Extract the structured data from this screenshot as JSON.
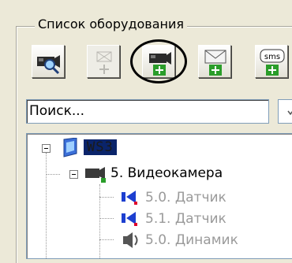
{
  "group": {
    "title": "Список оборудования"
  },
  "toolbar": {
    "buttons": [
      {
        "icon": "camera-search-icon",
        "enabled": true
      },
      {
        "icon": "device-add-icon",
        "enabled": false
      },
      {
        "icon": "camera-add-icon",
        "enabled": true,
        "highlighted": true
      },
      {
        "icon": "email-add-icon",
        "enabled": true
      },
      {
        "icon": "sms-add-icon",
        "enabled": true,
        "text": "sms"
      }
    ]
  },
  "search": {
    "value": "Поиск..."
  },
  "tree": {
    "nodes": [
      {
        "label": "WS3",
        "selected": true,
        "icon": "computer-icon"
      },
      {
        "label": "5. Видеокамера",
        "icon": "camera-icon"
      },
      {
        "label": "5.0. Датчик",
        "icon": "sensor-icon",
        "dimmed": true
      },
      {
        "label": "5.1. Датчик",
        "icon": "sensor-icon",
        "dimmed": true
      },
      {
        "label": "5.0. Динамик",
        "icon": "speaker-icon",
        "dimmed": true
      }
    ]
  },
  "colors": {
    "selection": "#0a246a",
    "plus": "#2a9d2a",
    "sensor": "#1d3fd0",
    "marker": "#e0002a"
  }
}
